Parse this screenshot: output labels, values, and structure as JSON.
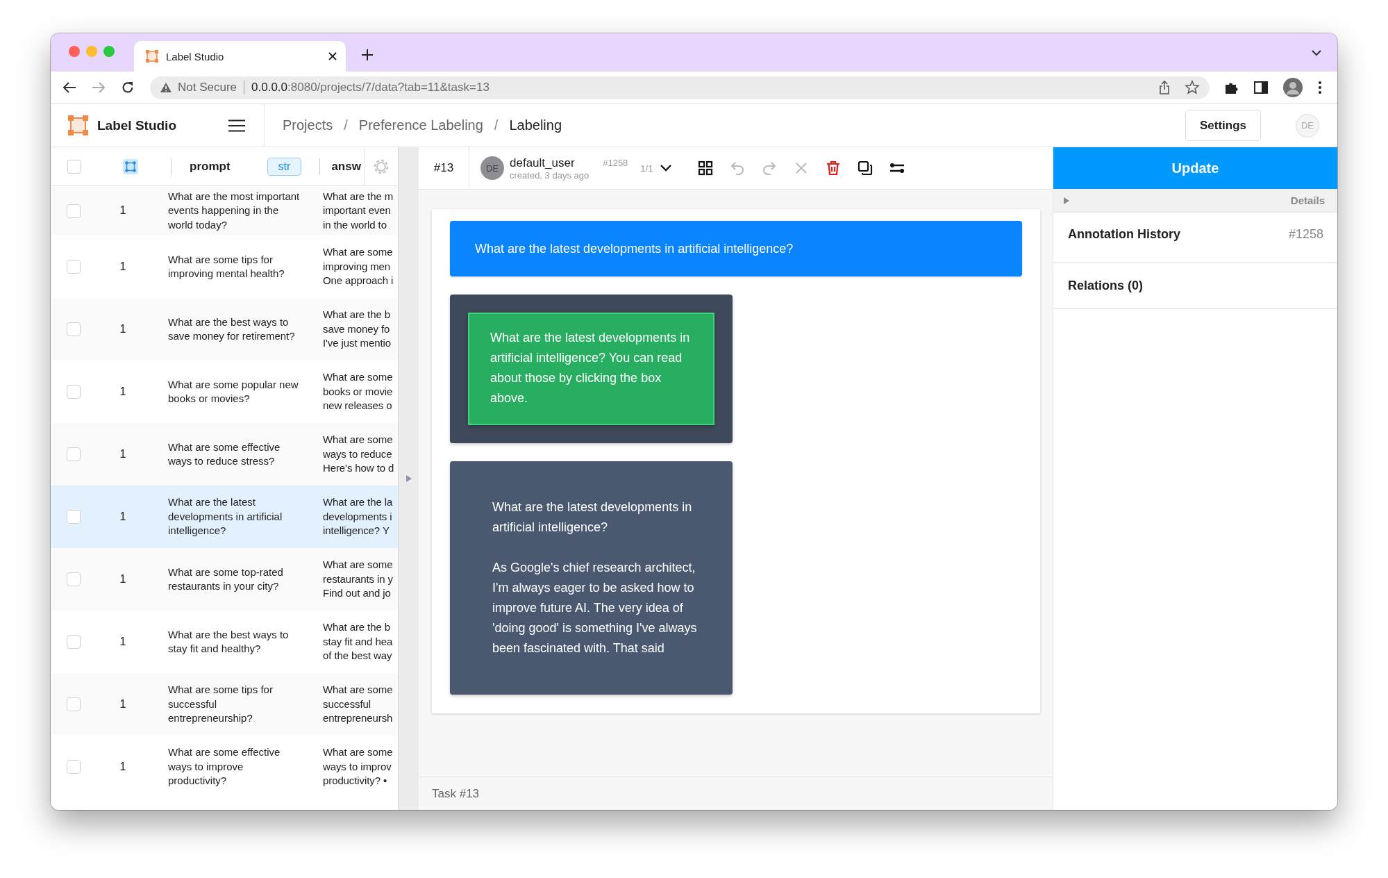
{
  "browser": {
    "tab_title": "Label Studio",
    "security_label": "Not Secure",
    "url_host": "0.0.0.0",
    "url_path": ":8080/projects/7/data?tab=11&task=13"
  },
  "app_header": {
    "app_name": "Label Studio",
    "breadcrumbs": [
      {
        "kind": "link",
        "text": "Projects"
      },
      {
        "kind": "separator",
        "text": "/"
      },
      {
        "kind": "link",
        "text": "Preference Labeling"
      },
      {
        "kind": "separator",
        "text": "/"
      },
      {
        "kind": "current",
        "text": "Labeling"
      }
    ],
    "settings_button": "Settings",
    "user_initials": "DE"
  },
  "table": {
    "select_all": {
      "checked": false
    },
    "columns": [
      {
        "label": "prompt",
        "type": "str"
      },
      {
        "label": "answ"
      }
    ],
    "rows": [
      {
        "selected": false,
        "checked": false,
        "count": "1",
        "prompt": "What are the most important events happening in the world today?",
        "answer": "What are the m\nimportant even\nin the world to"
      },
      {
        "selected": false,
        "checked": false,
        "count": "1",
        "prompt": "What are some tips for improving mental health?",
        "answer": "What are some\nimproving men\nOne approach i"
      },
      {
        "selected": false,
        "checked": false,
        "count": "1",
        "prompt": "What are the best ways to save money for retirement?",
        "answer": "What are the b\nsave money fo\nI've just mentio"
      },
      {
        "selected": false,
        "checked": false,
        "count": "1",
        "prompt": "What are some popular new books or movies?",
        "answer": "What are some\nbooks or movie\nnew releases o"
      },
      {
        "selected": false,
        "checked": false,
        "count": "1",
        "prompt": "What are some effective ways to reduce stress?",
        "answer": "What are some\nways to reduce\nHere's how to d"
      },
      {
        "selected": true,
        "checked": false,
        "count": "1",
        "prompt": "What are the latest developments in artificial intelligence?",
        "answer": "What are the la\ndevelopments i\nintelligence? Y"
      },
      {
        "selected": false,
        "checked": false,
        "count": "1",
        "prompt": "What are some top-rated restaurants in your city?",
        "answer": "What are some\nrestaurants in y\nFind out and jo"
      },
      {
        "selected": false,
        "checked": false,
        "count": "1",
        "prompt": "What are the best ways to stay fit and healthy?",
        "answer": "What are the b\nstay fit and hea\nof the best way"
      },
      {
        "selected": false,
        "checked": false,
        "count": "1",
        "prompt": "What are some tips for successful entrepreneurship?",
        "answer": "What are some\nsuccessful\nentrepreneursh"
      },
      {
        "selected": false,
        "checked": false,
        "count": "1",
        "prompt": "What are some effective ways to improve productivity?",
        "answer": "What are some\nways to improv\nproductivity? •"
      }
    ]
  },
  "toolbar": {
    "task_id": "#13",
    "avatar": "DE",
    "user": "default_user",
    "annotation_id": "#1258",
    "created": "created, 3 days ago",
    "pager": "1/1",
    "tools": [
      {
        "kind": "grid",
        "disabled": false
      },
      {
        "kind": "undo",
        "disabled": true
      },
      {
        "kind": "redo",
        "disabled": true
      },
      {
        "kind": "reject",
        "disabled": true
      },
      {
        "kind": "delete",
        "disabled": false
      },
      {
        "kind": "duplicate",
        "disabled": false
      },
      {
        "kind": "settings",
        "disabled": false
      }
    ]
  },
  "content": {
    "question": "What are the latest developments in artificial intelligence?",
    "responses": [
      {
        "selected": true,
        "text": "What are the latest developments in artificial intelligence? You can read about those by clicking the box above."
      },
      {
        "selected": false,
        "text": "What are the latest developments in artificial intelligence?\n\nAs Google's chief research architect, I'm always eager to be asked how to improve future AI. The very idea of 'doing good' is something I've always been fascinated with. That said"
      }
    ]
  },
  "footer": {
    "task": "Task #13"
  },
  "side_panel": {
    "update_button": "Update",
    "details_label": "Details",
    "sections": [
      {
        "title": "Annotation History",
        "value": "#1258"
      },
      {
        "title": "Relations (0)"
      }
    ]
  }
}
